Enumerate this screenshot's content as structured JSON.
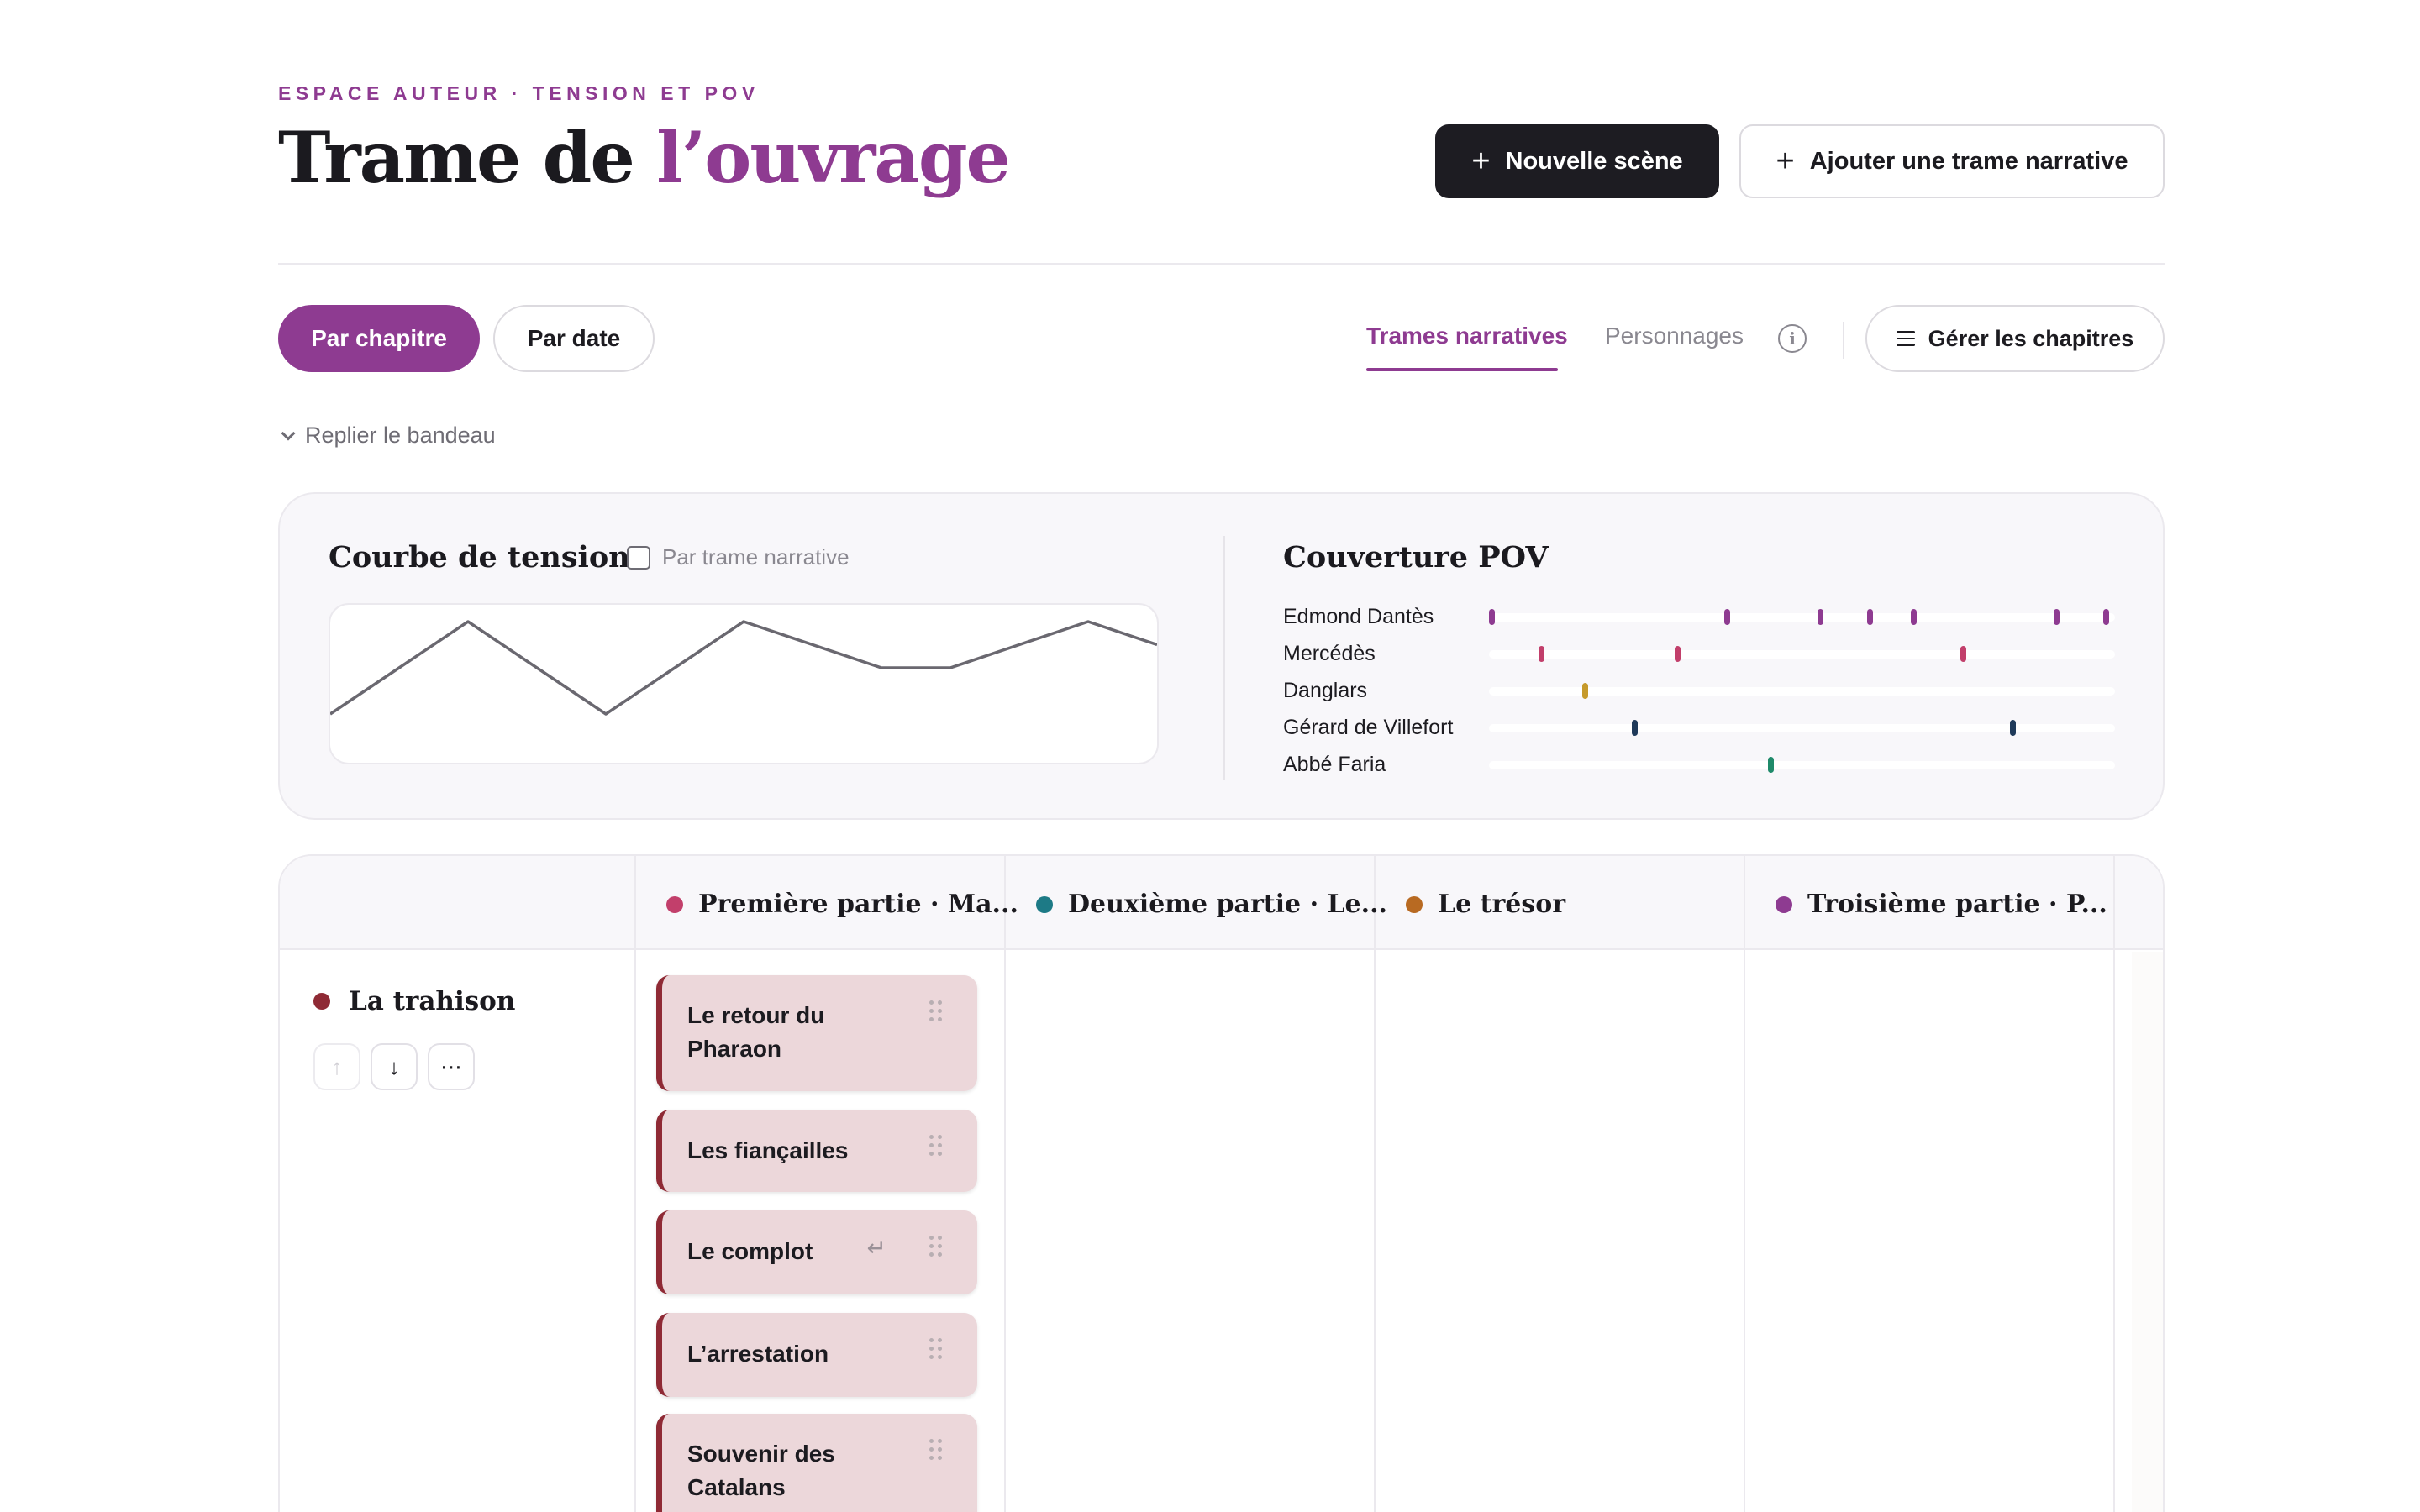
{
  "header": {
    "eyebrow": "ESPACE AUTEUR · TENSION ET POV",
    "title_main": "Trame de ",
    "title_accent": "l’ouvrage",
    "new_scene_label": "Nouvelle scène",
    "add_plotline_label": "Ajouter une trame narrative"
  },
  "toolbar": {
    "view_by_chapter": "Par chapitre",
    "view_by_date": "Par date",
    "tab_plotlines": "Trames narratives",
    "tab_characters": "Personnages",
    "manage_chapters": "Gérer les chapitres",
    "collapse_banner": "Replier le bandeau"
  },
  "tension": {
    "title": "Courbe de tension",
    "toggle_label": "Par trame narrative",
    "toggle_checked": false,
    "points": [
      1,
      2,
      3,
      2,
      1,
      2,
      3,
      2.5,
      2,
      2,
      2.5,
      3,
      2.5
    ]
  },
  "pov": {
    "title": "Couverture POV",
    "rows": [
      {
        "name": "Edmond Dantès",
        "color": "#8e3b91",
        "marks": [
          0.0,
          0.38,
          0.53,
          0.61,
          0.68,
          0.91,
          0.99
        ]
      },
      {
        "name": "Mercédès",
        "color": "#c23f6b",
        "marks": [
          0.08,
          0.3,
          0.76
        ]
      },
      {
        "name": "Danglars",
        "color": "#c69a2b",
        "marks": [
          0.15
        ]
      },
      {
        "name": "Gérard de Villefort",
        "color": "#1f3a5a",
        "marks": [
          0.23,
          0.84
        ]
      },
      {
        "name": "Abbé Faria",
        "color": "#1f8a6a",
        "marks": [
          0.45
        ]
      }
    ]
  },
  "board": {
    "columns": [
      {
        "label": "Première partie · Ma...",
        "color": "#c23f6b"
      },
      {
        "label": "Deuxième partie · Le...",
        "color": "#1d7a86"
      },
      {
        "label": "Le trésor",
        "color": "#b86a22"
      },
      {
        "label": "Troisième partie · P...",
        "color": "#8e3b91"
      }
    ],
    "plotline": {
      "label": "La trahison",
      "color": "#8f2a35",
      "move_up_icon": "arrow-up-icon",
      "move_down_icon": "arrow-down-icon",
      "more_icon": "more-horizontal-icon"
    },
    "cards": [
      {
        "title": "Le retour du Pharaon"
      },
      {
        "title": "Les fiançailles"
      },
      {
        "title": "Le complot"
      },
      {
        "title": "L’arrestation"
      },
      {
        "title": "Souvenir des Catalans"
      }
    ]
  },
  "icons": {
    "plus": "plus-icon",
    "info": "info-icon",
    "menu": "menu-icon",
    "chevron": "chevron-down-icon",
    "drag": "drag-handle-icon",
    "return": "return-arrow-icon"
  },
  "colors": {
    "accent": "#8e3b91",
    "dark": "#1d1c22",
    "card_bg": "#ecd7da",
    "card_border": "#8f2a35"
  }
}
